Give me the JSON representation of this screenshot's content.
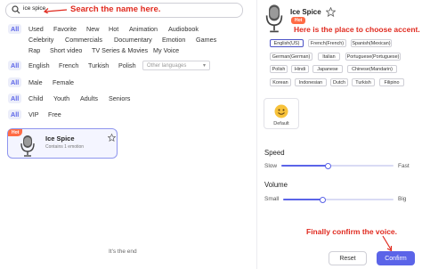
{
  "search": {
    "value": "ice spice",
    "annotation": "Search the name here."
  },
  "filters": {
    "row1": [
      "All",
      "Used",
      "Favorite",
      "New",
      "Hot",
      "Animation",
      "Audiobook"
    ],
    "row2": [
      "Celebrity",
      "Commercials",
      "Documentary",
      "Emotion",
      "Games"
    ],
    "row3": [
      "Rap",
      "Short video",
      "TV Series & Movies",
      "My Voice"
    ],
    "lang": [
      "All",
      "English",
      "French",
      "Turkish",
      "Polish"
    ],
    "lang_other_placeholder": "Other languages",
    "gender": [
      "All",
      "Male",
      "Female"
    ],
    "age": [
      "All",
      "Child",
      "Youth",
      "Adults",
      "Seniors"
    ],
    "tier": [
      "All",
      "VIP",
      "Free"
    ]
  },
  "voice_card": {
    "tag": "Hot",
    "name": "Ice Spice",
    "subtitle": "Contains 1 emotion"
  },
  "end_text": "It's the end",
  "detail": {
    "name": "Ice Spice",
    "tag": "Hot",
    "accent_annotation": "Here is the place to choose accent.",
    "accents": [
      "English(US)",
      "French(French)",
      "Spanish(Mexican)",
      "German(German)",
      "Italian",
      "Portuguese(Portuguese)",
      "Polish",
      "Hindi",
      "Japanese",
      "Chinese(Mandarin)",
      "Korean",
      "Indonesian",
      "Dutch",
      "Turkish",
      "Filipino"
    ],
    "emotion_default_label": "Default",
    "speed": {
      "title": "Speed",
      "min_label": "Slow",
      "max_label": "Fast",
      "value": 0.42
    },
    "volume": {
      "title": "Volume",
      "min_label": "Small",
      "max_label": "Big",
      "value": 0.36
    },
    "final_annotation": "Finally confirm the voice.",
    "reset_label": "Reset",
    "confirm_label": "Confirm"
  },
  "colors": {
    "accent": "#5b64e8",
    "annotation": "#e02a1f",
    "hot": "#ff6b45"
  }
}
